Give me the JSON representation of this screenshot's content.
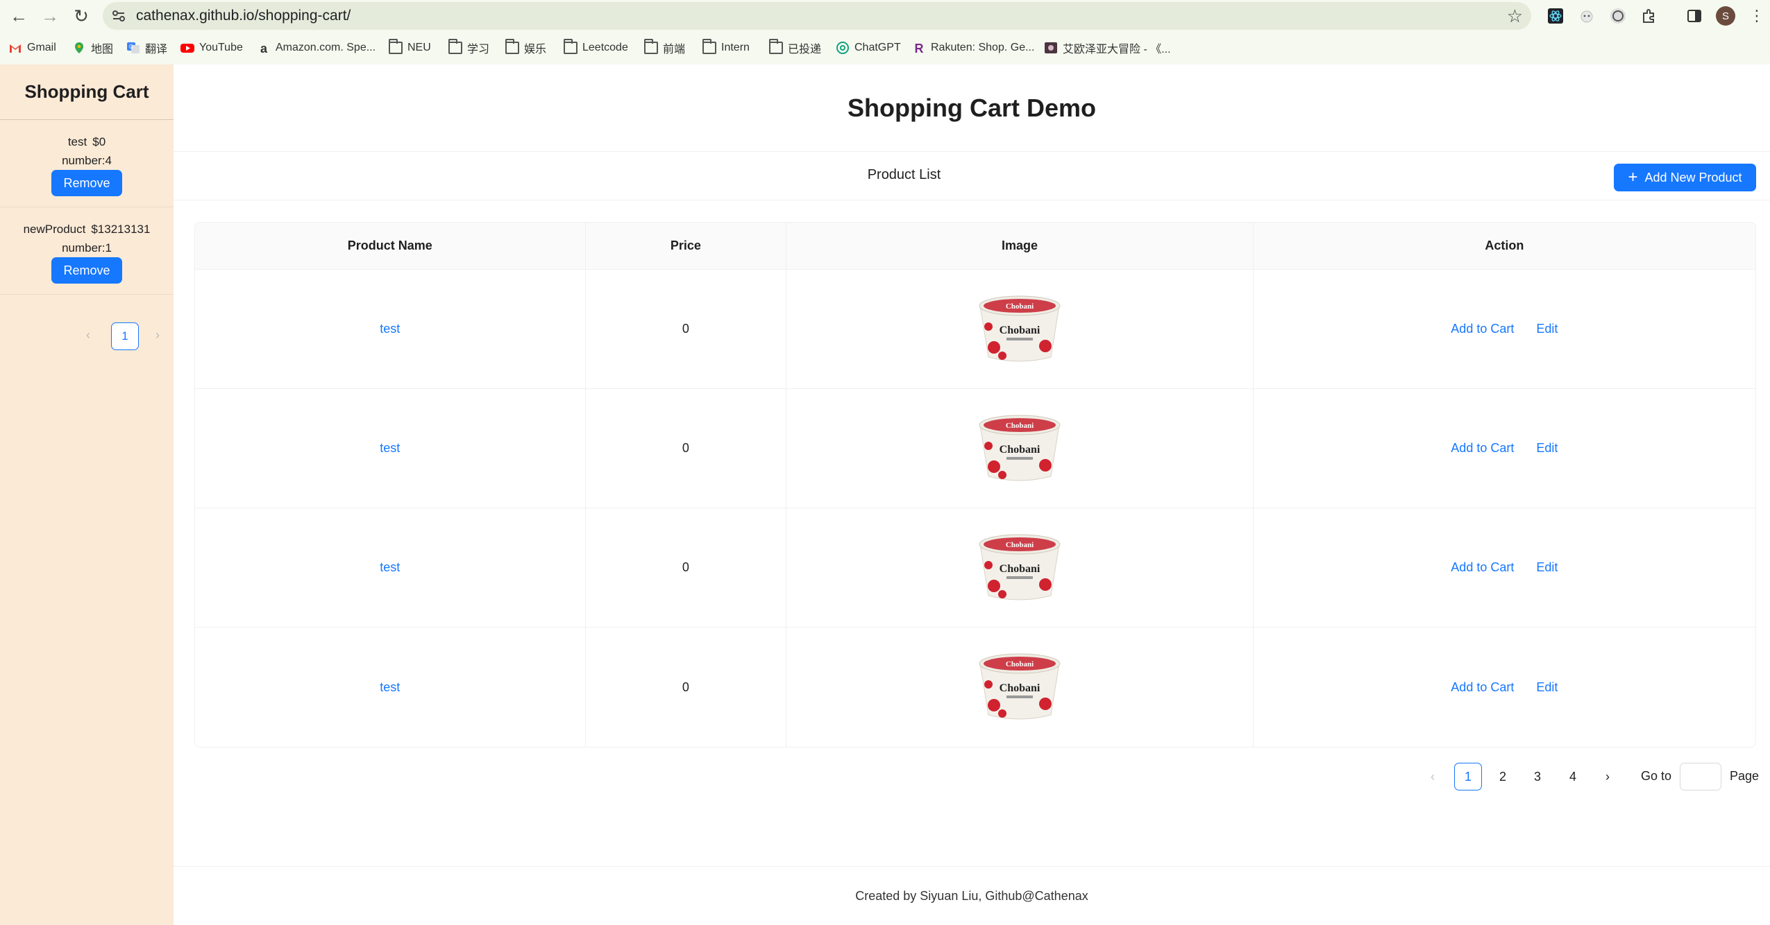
{
  "browser": {
    "url": "cathenax.github.io/shopping-cart/",
    "profile_initial": "S",
    "bookmarks": [
      {
        "label": "Gmail",
        "icon": "gmail-icon"
      },
      {
        "label": "地图",
        "icon": "maps-icon"
      },
      {
        "label": "翻译",
        "icon": "translate-icon"
      },
      {
        "label": "YouTube",
        "icon": "youtube-icon"
      },
      {
        "label": "Amazon.com. Spe...",
        "icon": "amazon-icon"
      },
      {
        "label": "NEU",
        "icon": "folder-icon"
      },
      {
        "label": "学习",
        "icon": "folder-icon"
      },
      {
        "label": "娱乐",
        "icon": "folder-icon"
      },
      {
        "label": "Leetcode",
        "icon": "folder-icon"
      },
      {
        "label": "前端",
        "icon": "folder-icon"
      },
      {
        "label": "Intern",
        "icon": "folder-icon"
      },
      {
        "label": "已投递",
        "icon": "folder-icon"
      },
      {
        "label": "ChatGPT",
        "icon": "chatgpt-icon"
      },
      {
        "label": "Rakuten: Shop. Ge...",
        "icon": "rakuten-icon"
      },
      {
        "label": "艾欧泽亚大冒险 - 《...",
        "icon": "game-icon"
      }
    ]
  },
  "sidebar": {
    "title": "Shopping Cart",
    "items": [
      {
        "name": "test",
        "price": "$0",
        "number": "number:4",
        "remove_label": "Remove"
      },
      {
        "name": "newProduct",
        "price": "$13213131",
        "number": "number:1",
        "remove_label": "Remove"
      }
    ],
    "pager": {
      "current": "1"
    }
  },
  "main": {
    "title": "Shopping Cart Demo",
    "list_title": "Product List",
    "add_button": "Add New Product",
    "columns": [
      "Product Name",
      "Price",
      "Image",
      "Action"
    ],
    "rows": [
      {
        "name": "test",
        "price": "0",
        "image": "chobani-yogurt-image",
        "add_label": "Add to Cart",
        "edit_label": "Edit"
      },
      {
        "name": "test",
        "price": "0",
        "image": "chobani-yogurt-image",
        "add_label": "Add to Cart",
        "edit_label": "Edit"
      },
      {
        "name": "test",
        "price": "0",
        "image": "chobani-yogurt-image",
        "add_label": "Add to Cart",
        "edit_label": "Edit"
      },
      {
        "name": "test",
        "price": "0",
        "image": "chobani-yogurt-image",
        "add_label": "Add to Cart",
        "edit_label": "Edit"
      }
    ],
    "pagination": {
      "pages": [
        "1",
        "2",
        "3",
        "4"
      ],
      "current": "1",
      "goto_label": "Go to",
      "page_label": "Page",
      "goto_value": ""
    },
    "footer": "Created by Siyuan Liu, Github@Cathenax"
  },
  "colors": {
    "accent": "#1677ff",
    "sidebar_bg": "#fbead6",
    "chrome_bg": "#f5f9ef"
  }
}
